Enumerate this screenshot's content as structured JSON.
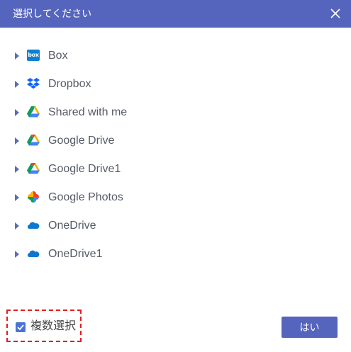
{
  "dialog": {
    "title": "選択してください",
    "close_icon": "close-icon"
  },
  "tree": {
    "items": [
      {
        "label": "Box",
        "icon": "box-icon",
        "icon_text": "box"
      },
      {
        "label": "Dropbox",
        "icon": "dropbox-icon"
      },
      {
        "label": "Shared with me",
        "icon": "google-drive-icon"
      },
      {
        "label": "Google Drive",
        "icon": "google-drive-icon"
      },
      {
        "label": "Google Drive1",
        "icon": "google-drive-icon"
      },
      {
        "label": "Google Photos",
        "icon": "google-photos-icon"
      },
      {
        "label": "OneDrive",
        "icon": "onedrive-icon"
      },
      {
        "label": "OneDrive1",
        "icon": "onedrive-icon"
      }
    ]
  },
  "footer": {
    "multi_select_label": "複数選択",
    "multi_select_checked": true,
    "ok_label": "はい"
  },
  "colors": {
    "header": "#5565bd",
    "checkbox": "#4a73d9",
    "highlight_border": "#e31d1d",
    "button": "#5565bd"
  }
}
